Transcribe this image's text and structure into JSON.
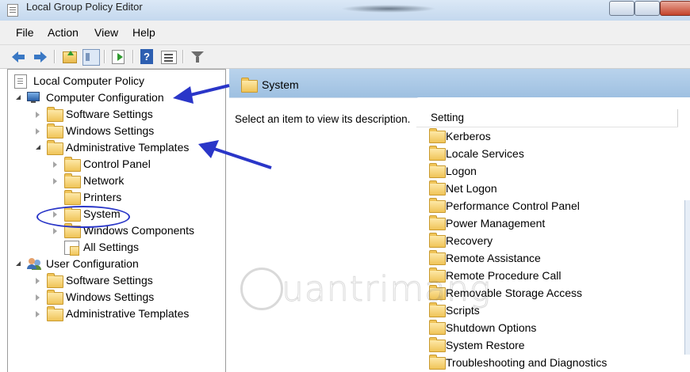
{
  "window": {
    "title": "Local Group Policy Editor"
  },
  "menu": [
    "File",
    "Action",
    "View",
    "Help"
  ],
  "toolbar": {
    "buttons": [
      "back-arrow-icon",
      "forward-arrow-icon",
      "up-folder-icon",
      "show-hide-tree-icon",
      "export-list-icon",
      "help-icon",
      "properties-icon",
      "filter-icon"
    ]
  },
  "tree": {
    "root": "Local Computer Policy",
    "computer_configuration": "Computer Configuration",
    "software_settings": "Software Settings",
    "windows_settings": "Windows Settings",
    "administrative_templates": "Administrative Templates",
    "control_panel": "Control Panel",
    "network": "Network",
    "printers": "Printers",
    "system": "System",
    "windows_components": "Windows Components",
    "all_settings": "All Settings",
    "user_configuration": "User Configuration",
    "user_software_settings": "Software Settings",
    "user_windows_settings": "Windows Settings",
    "user_administrative_templates": "Administrative Templates"
  },
  "detail": {
    "header_title": "System",
    "description": "Select an item to view its description.",
    "column_header": "Setting",
    "items": [
      "Kerberos",
      "Locale Services",
      "Logon",
      "Net Logon",
      "Performance Control Panel",
      "Power Management",
      "Recovery",
      "Remote Assistance",
      "Remote Procedure Call",
      "Removable Storage Access",
      "Scripts",
      "Shutdown Options",
      "System Restore",
      "Troubleshooting and Diagnostics"
    ]
  },
  "watermark": {
    "text": "uantrimang"
  },
  "colors": {
    "annotation_blue": "#2a36c8",
    "header_blue": "#9ec0e1",
    "folder_yellow": "#f0c458"
  }
}
